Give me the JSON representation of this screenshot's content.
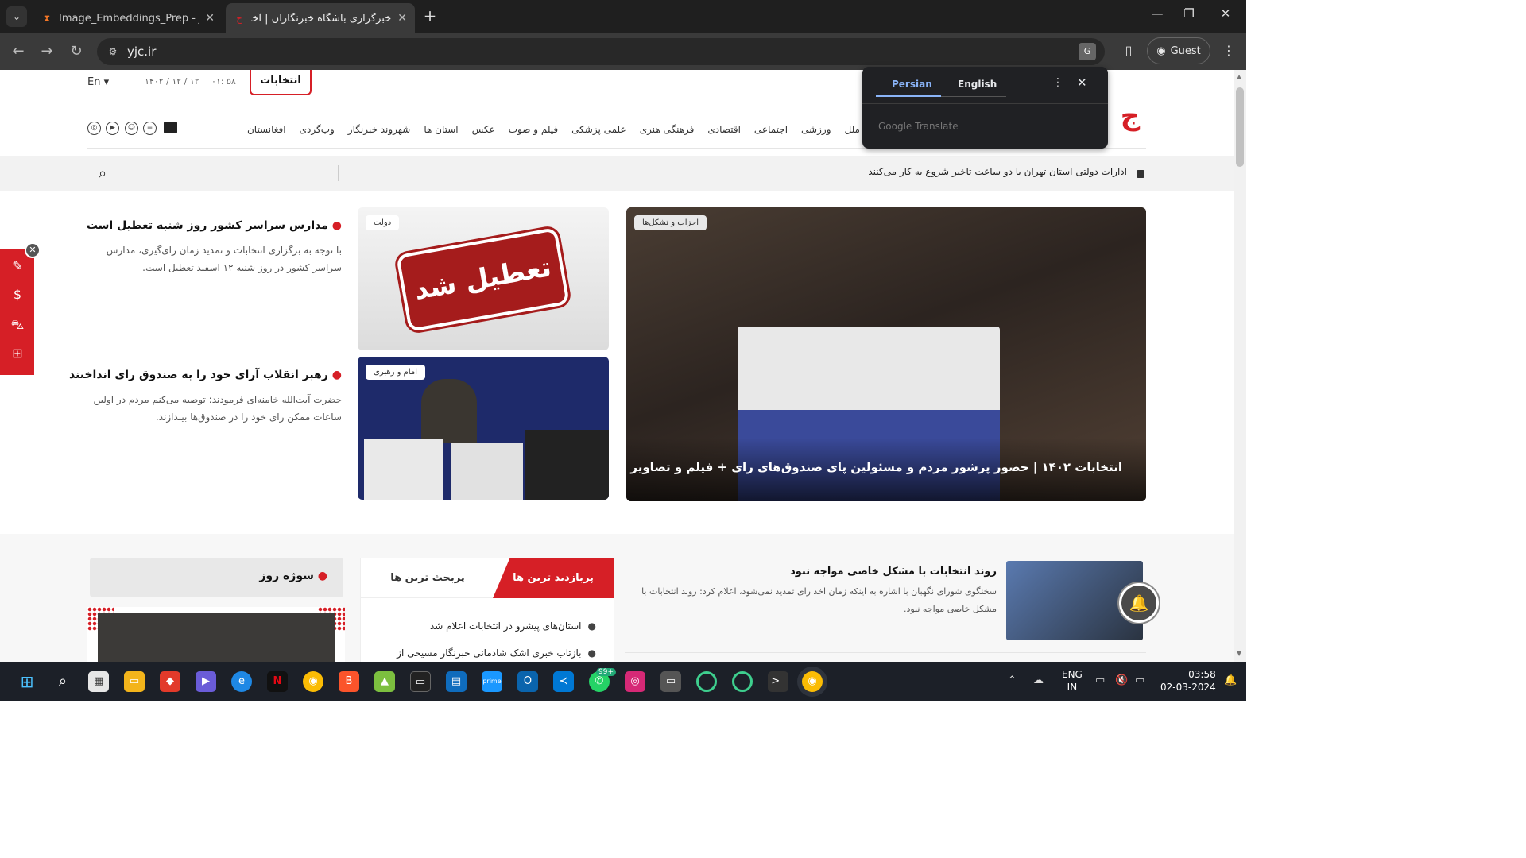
{
  "browser": {
    "tabs": [
      {
        "title": "Image_Embeddings_Prep - Jupy",
        "icon": "jupyter-icon"
      },
      {
        "title": "خبرگزاری باشگاه خبرنگاران | آخرین",
        "icon": "yjc-icon"
      }
    ],
    "url": "yjc.ir",
    "profile_label": "Guest"
  },
  "translate_popup": {
    "lang_source": "Persian",
    "lang_target": "English",
    "brand": "Google Translate"
  },
  "site": {
    "lang_switch": "En",
    "date": "۱۴۰۲ / ۱۲ / ۱۲",
    "time": "۰۱: ۵۸",
    "election_button": "انتخابات",
    "nav": [
      "ملل",
      "ورزشی",
      "اجتماعی",
      "اقتصادی",
      "فرهنگی هنری",
      "علمی پزشکی",
      "فیلم و صوت",
      "عکس",
      "استان ها",
      "شهروند خبرنگار",
      "وب‌گردی",
      "افغانستان"
    ],
    "ticker_text": "ادارات دولتی استان تهران با دو ساعت تاخیر شروع به کار می‌کنند"
  },
  "hero": {
    "tag": "احزاب و تشکل‌ها",
    "title": "انتخابات ۱۴۰۲ | حضور پرشور مردم و مسئولین پای صندوق‌های رای + فیلم و تصاویر"
  },
  "cards": [
    {
      "tag": "دولت",
      "sign_text": "تعطیل شد"
    },
    {
      "tag": "امام و رهبری"
    }
  ],
  "news": [
    {
      "title": "مدارس سراسر کشور روز شنبه تعطیل است",
      "summary": "با توجه به برگزاری انتخابات و تمدید زمان رای‌گیری، مدارس سراسر کشور در روز شنبه ۱۲ اسفند تعطیل است."
    },
    {
      "title": "رهبر انقلاب آرای خود را به صندوق رای انداختند",
      "summary": "حضرت آیت‌الله خامنه‌ای فرمودند: توصیه می‌کنم مردم در اولین ساعات ممکن رای خود را در صندوق‌ها بیندازند."
    }
  ],
  "sujeh_label": "سوژه روز",
  "tabs_box": {
    "active": "پربازدید ترین ها",
    "inactive": "پربحث ترین ها",
    "items": [
      "استان‌های پیشرو در انتخابات اعلام شد",
      "بازتاب خبری اشک شادمانی خبرنگار مسیحی از"
    ]
  },
  "tip": {
    "title": "روند انتخابات با مشکل خاصی مواجه نبود",
    "summary": "سخنگوی شورای نگهبان با اشاره به اینکه زمان اخذ رای تمدید نمی‌شود، اعلام کرد: روند انتخابات با مشکل خاصی مواجه نبود."
  },
  "taskbar": {
    "lang_line1": "ENG",
    "lang_line2": "IN",
    "time": "03:58",
    "date": "02-03-2024",
    "whatsapp_badge": "99+"
  },
  "colors": {
    "brand_red": "#d61f26",
    "chrome_dark": "#1f1f1f",
    "translate_blue": "#8ab4f8"
  }
}
